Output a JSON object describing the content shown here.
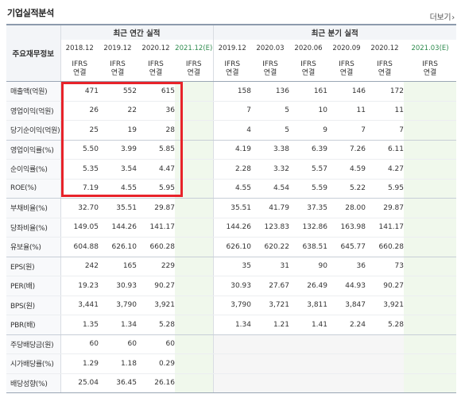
{
  "header": {
    "title": "기업실적분석",
    "more_label": "더보기"
  },
  "table": {
    "corner_label": "주요재무정보",
    "groups": {
      "annual": "최근 연간 실적",
      "quarterly": "최근 분기 실적"
    },
    "annual_periods": [
      "2018.12",
      "2019.12",
      "2020.12",
      "2021.12(E)"
    ],
    "quarter_periods": [
      "2019.12",
      "2020.03",
      "2020.06",
      "2020.09",
      "2020.12",
      "2021.03(E)"
    ],
    "std_line1": "IFRS",
    "std_line2": "연결",
    "rows": [
      {
        "label": "매출액(억원)",
        "annual": [
          "471",
          "552",
          "615",
          ""
        ],
        "quarterly": [
          "158",
          "136",
          "161",
          "146",
          "172",
          ""
        ]
      },
      {
        "label": "영업이익(억원)",
        "annual": [
          "26",
          "22",
          "36",
          ""
        ],
        "quarterly": [
          "7",
          "5",
          "10",
          "11",
          "11",
          ""
        ]
      },
      {
        "label": "당기순이익(억원)",
        "annual": [
          "25",
          "19",
          "28",
          ""
        ],
        "quarterly": [
          "4",
          "5",
          "9",
          "7",
          "7",
          ""
        ]
      },
      {
        "label": "영업이익률(%)",
        "annual": [
          "5.50",
          "3.99",
          "5.85",
          ""
        ],
        "quarterly": [
          "4.19",
          "3.38",
          "6.39",
          "7.26",
          "6.11",
          ""
        ]
      },
      {
        "label": "순이익률(%)",
        "annual": [
          "5.35",
          "3.54",
          "4.47",
          ""
        ],
        "quarterly": [
          "2.28",
          "3.32",
          "5.57",
          "4.59",
          "4.27",
          ""
        ]
      },
      {
        "label": "ROE(%)",
        "annual": [
          "7.19",
          "4.55",
          "5.95",
          ""
        ],
        "quarterly": [
          "4.55",
          "4.54",
          "5.59",
          "5.22",
          "5.95",
          ""
        ]
      },
      {
        "label": "부채비율(%)",
        "annual": [
          "32.70",
          "35.51",
          "29.87",
          ""
        ],
        "quarterly": [
          "35.51",
          "41.79",
          "37.35",
          "28.00",
          "29.87",
          ""
        ]
      },
      {
        "label": "당좌비율(%)",
        "annual": [
          "149.05",
          "144.26",
          "141.17",
          ""
        ],
        "quarterly": [
          "144.26",
          "123.83",
          "132.86",
          "163.98",
          "141.17",
          ""
        ]
      },
      {
        "label": "유보율(%)",
        "annual": [
          "604.88",
          "626.10",
          "660.28",
          ""
        ],
        "quarterly": [
          "626.10",
          "620.22",
          "638.51",
          "645.77",
          "660.28",
          ""
        ]
      },
      {
        "label": "EPS(원)",
        "annual": [
          "242",
          "165",
          "229",
          ""
        ],
        "quarterly": [
          "35",
          "31",
          "90",
          "36",
          "73",
          ""
        ]
      },
      {
        "label": "PER(배)",
        "annual": [
          "19.23",
          "30.93",
          "90.27",
          ""
        ],
        "quarterly": [
          "30.93",
          "27.67",
          "26.49",
          "44.93",
          "90.27",
          ""
        ]
      },
      {
        "label": "BPS(원)",
        "annual": [
          "3,441",
          "3,790",
          "3,921",
          ""
        ],
        "quarterly": [
          "3,790",
          "3,721",
          "3,811",
          "3,847",
          "3,921",
          ""
        ]
      },
      {
        "label": "PBR(배)",
        "annual": [
          "1.35",
          "1.34",
          "5.28",
          ""
        ],
        "quarterly": [
          "1.34",
          "1.21",
          "1.41",
          "2.24",
          "5.28",
          ""
        ]
      },
      {
        "label": "주당배당금(원)",
        "annual": [
          "60",
          "60",
          "60",
          ""
        ],
        "quarterly": [
          "",
          "",
          "",
          "",
          "",
          ""
        ]
      },
      {
        "label": "시가배당률(%)",
        "annual": [
          "1.29",
          "1.18",
          "0.29",
          ""
        ],
        "quarterly": [
          "",
          "",
          "",
          "",
          "",
          ""
        ]
      },
      {
        "label": "배당성향(%)",
        "annual": [
          "25.04",
          "36.45",
          "26.16",
          ""
        ],
        "quarterly": [
          "",
          "",
          "",
          "",
          "",
          ""
        ]
      }
    ]
  },
  "colors": {
    "highlight_box": "#e8232a",
    "ifrs_text": "#e8521c",
    "estimate_text": "#2e8b4e",
    "estimate_bg": "#f0f8ec",
    "header_bg": "#f3f5f8",
    "top_border": "#8c9aad"
  }
}
